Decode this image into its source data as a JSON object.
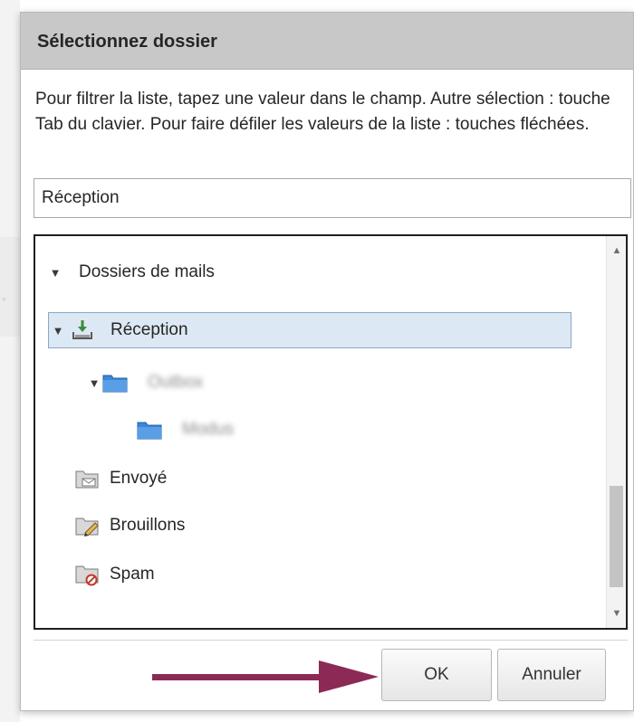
{
  "dialog": {
    "title": "Sélectionnez dossier",
    "instructions": "Pour filtrer la liste, tapez une valeur dans le champ. Autre sélection : touche Tab du clavier. Pour faire défiler les valeurs de la liste : touches fléchées.",
    "filter_value": "Réception"
  },
  "tree": {
    "root_label": "Dossiers de mails",
    "items": [
      {
        "label": "Réception",
        "icon": "inbox-download-icon",
        "selected": true
      },
      {
        "label": "Outbox",
        "icon": "folder-icon",
        "blurred": true
      },
      {
        "label": "Modus",
        "icon": "folder-icon",
        "blurred": true
      },
      {
        "label": "Envoyé",
        "icon": "sent-folder-icon"
      },
      {
        "label": "Brouillons",
        "icon": "drafts-folder-icon"
      },
      {
        "label": "Spam",
        "icon": "spam-folder-icon"
      }
    ]
  },
  "buttons": {
    "ok_label": "OK",
    "cancel_label": "Annuler"
  },
  "colors": {
    "titlebar": "#c8c8c8",
    "selection": "#dce8f4",
    "arrow": "#8c2a55",
    "folder": "#3b86d8"
  }
}
